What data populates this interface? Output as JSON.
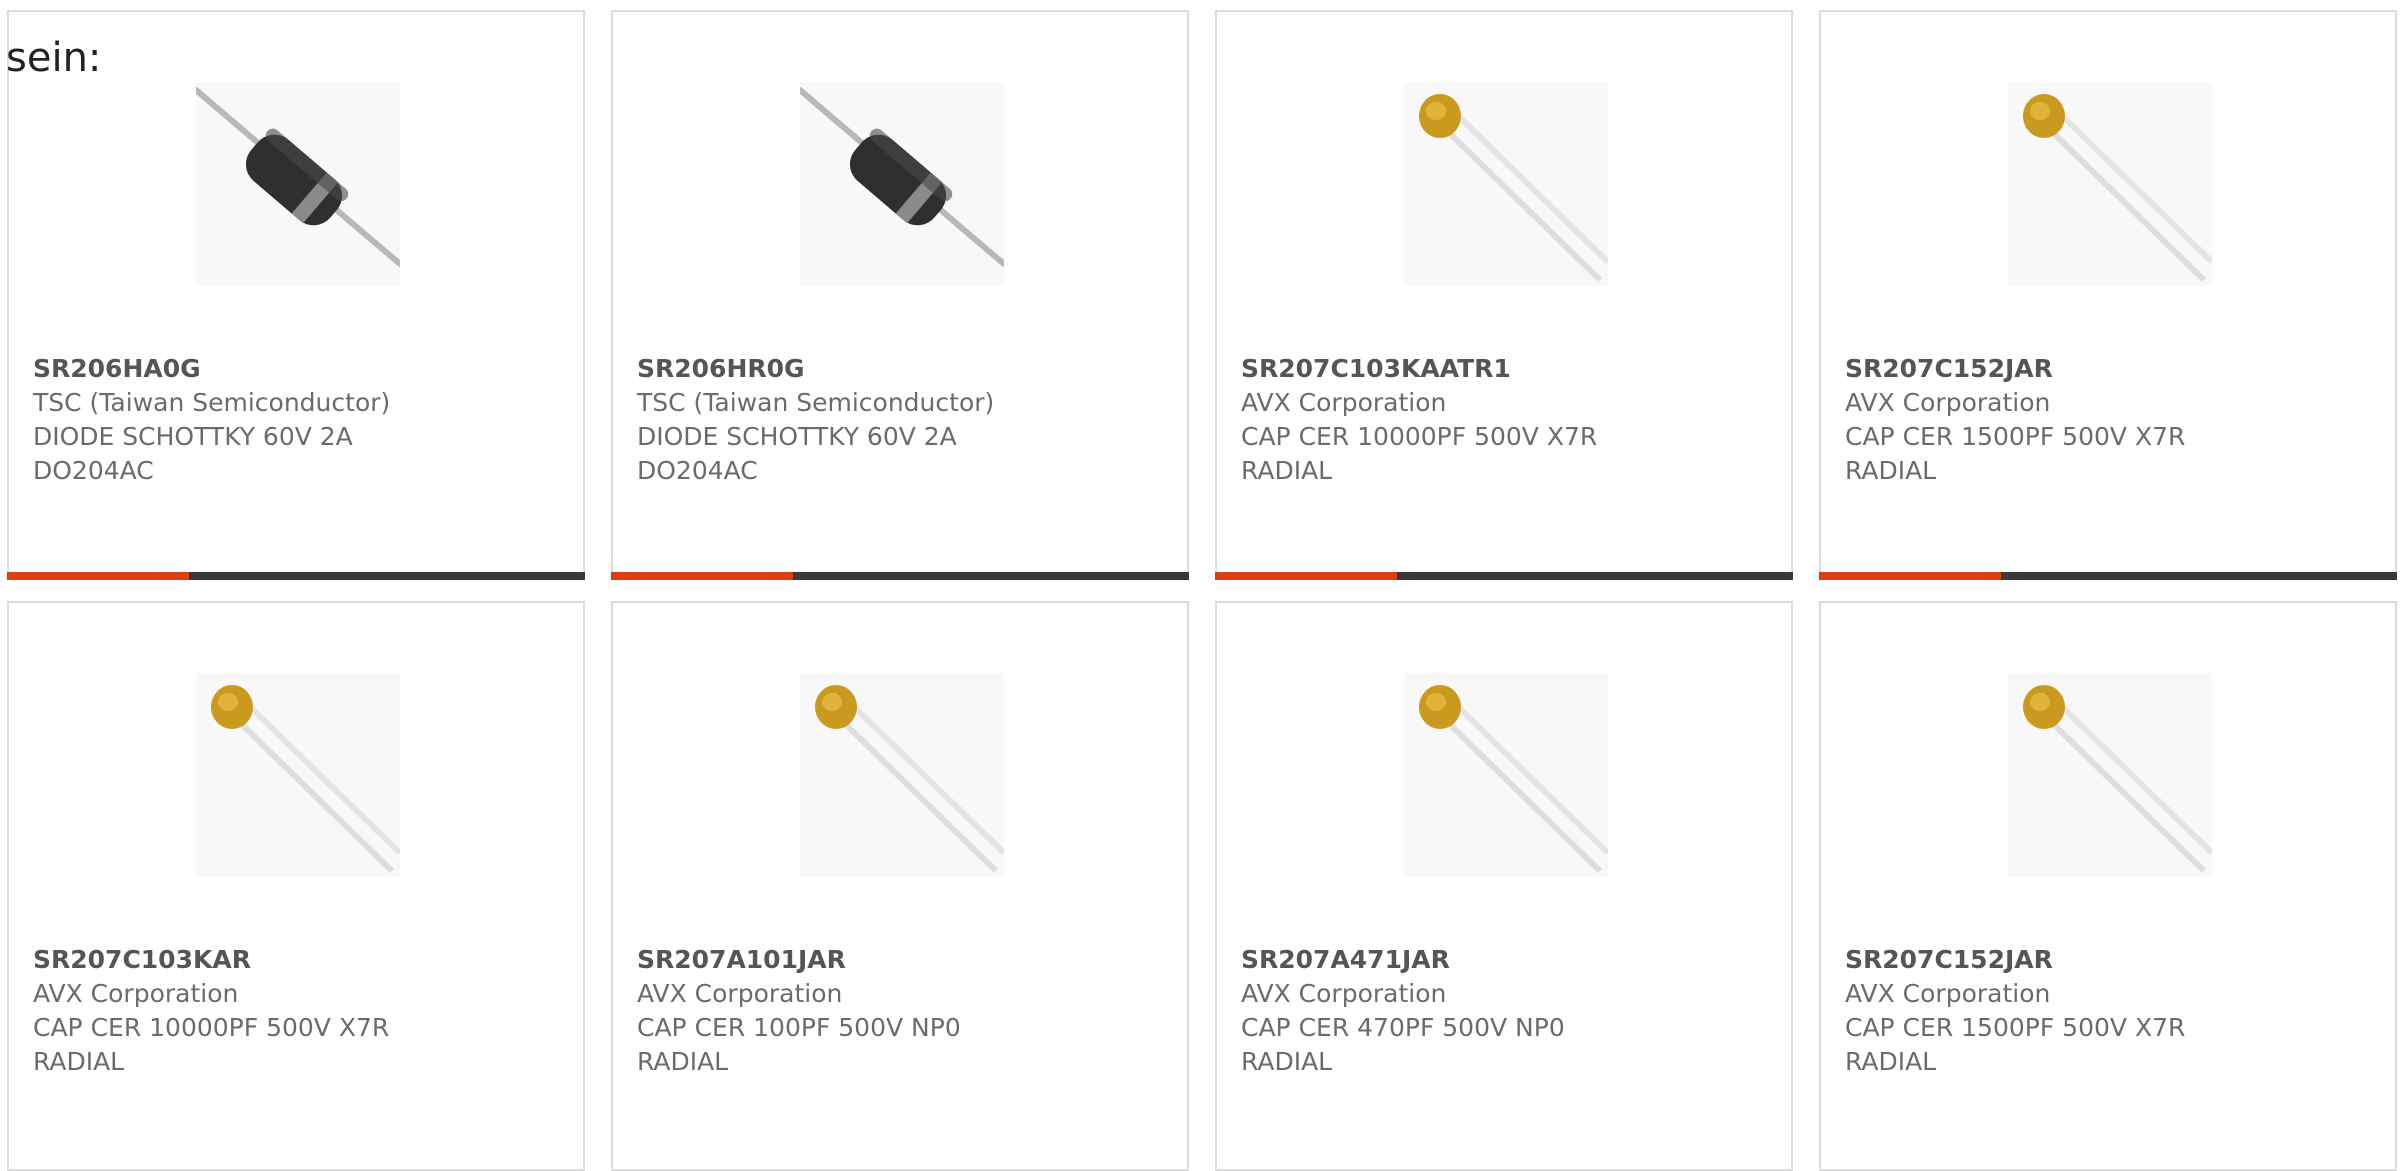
{
  "heading": "sein:",
  "colors": {
    "accent": "#e03c12",
    "bar": "#3a3a3a",
    "border": "#dcdcdc",
    "text": "#6b6b6b"
  },
  "cards": [
    {
      "part": "SR206HA0G",
      "maker": "TSC (Taiwan Semiconductor)",
      "desc1": "DIODE SCHOTTKY 60V 2A",
      "desc2": "DO204AC",
      "icon": "diode-icon"
    },
    {
      "part": "SR206HR0G",
      "maker": "TSC (Taiwan Semiconductor)",
      "desc1": "DIODE SCHOTTKY 60V 2A",
      "desc2": "DO204AC",
      "icon": "diode-icon"
    },
    {
      "part": "SR207C103KAATR1",
      "maker": "AVX Corporation",
      "desc1": "CAP CER 10000PF 500V X7R",
      "desc2": "RADIAL",
      "icon": "capacitor-icon"
    },
    {
      "part": "SR207C152JAR",
      "maker": "AVX Corporation",
      "desc1": "CAP CER 1500PF 500V X7R",
      "desc2": "RADIAL",
      "icon": "capacitor-icon"
    },
    {
      "part": "SR207C103KAR",
      "maker": "AVX Corporation",
      "desc1": "CAP CER 10000PF 500V X7R",
      "desc2": "RADIAL",
      "icon": "capacitor-icon"
    },
    {
      "part": "SR207A101JAR",
      "maker": "AVX Corporation",
      "desc1": "CAP CER 100PF 500V NP0",
      "desc2": "RADIAL",
      "icon": "capacitor-icon"
    },
    {
      "part": "SR207A471JAR",
      "maker": "AVX Corporation",
      "desc1": "CAP CER 470PF 500V NP0",
      "desc2": "RADIAL",
      "icon": "capacitor-icon"
    },
    {
      "part": "SR207C152JAR",
      "maker": "AVX Corporation",
      "desc1": "CAP CER 1500PF 500V X7R",
      "desc2": "RADIAL",
      "icon": "capacitor-icon"
    }
  ]
}
